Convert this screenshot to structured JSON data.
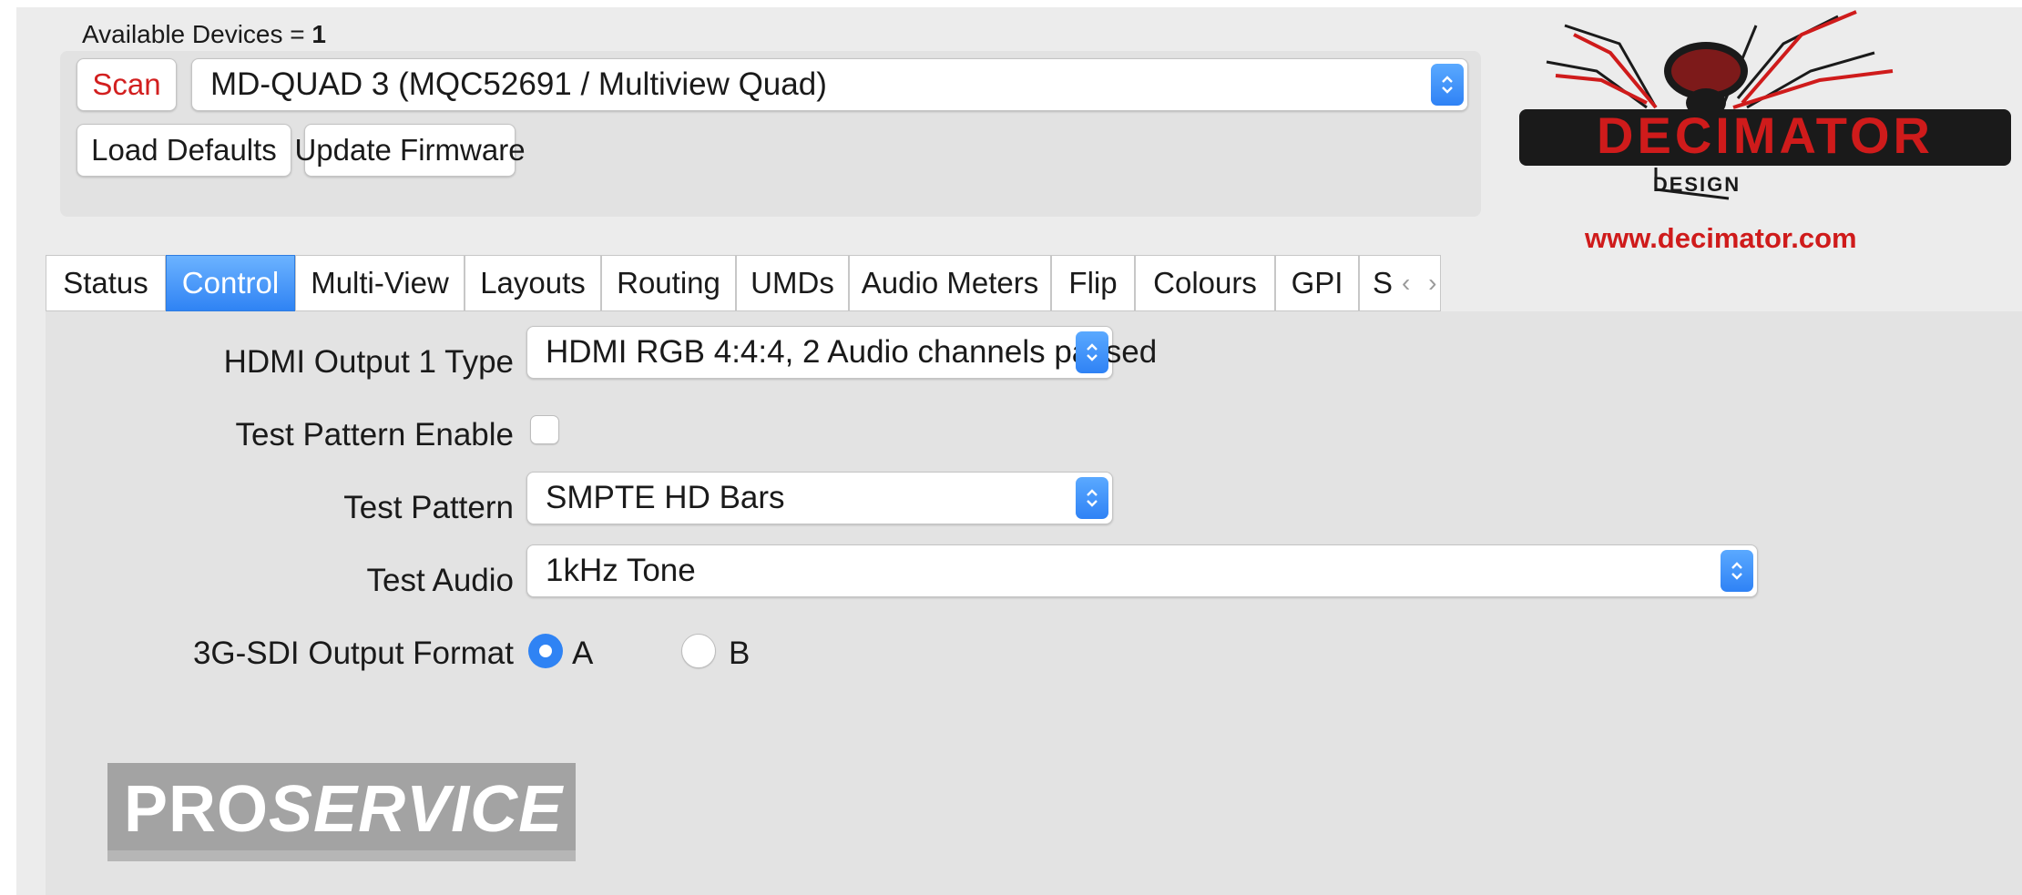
{
  "header": {
    "available_label": "Available Devices = ",
    "available_count": "1",
    "scan_label": "Scan",
    "device_selected": "MD-QUAD 3 (MQC52691 / Multiview Quad)",
    "load_defaults_label": "Load Defaults",
    "update_firmware_label": "Update Firmware"
  },
  "brand": {
    "logo_word": "DECIMATOR",
    "logo_sub": "DESIGN",
    "url": "www.decimator.com",
    "colors": {
      "red": "#cf1b1b",
      "dark": "#1a1a1a"
    }
  },
  "tabs": [
    {
      "label": "Status",
      "active": false
    },
    {
      "label": "Control",
      "active": true
    },
    {
      "label": "Multi-View",
      "active": false
    },
    {
      "label": "Layouts",
      "active": false
    },
    {
      "label": "Routing",
      "active": false
    },
    {
      "label": "UMDs",
      "active": false
    },
    {
      "label": "Audio Meters",
      "active": false
    },
    {
      "label": "Flip",
      "active": false
    },
    {
      "label": "Colours",
      "active": false
    },
    {
      "label": "GPI",
      "active": false
    }
  ],
  "tab_overflow": {
    "label": "S",
    "arrows": "‹ ›"
  },
  "control": {
    "hdmi_output_label": "HDMI Output 1 Type",
    "hdmi_output_value": "HDMI RGB 4:4:4, 2 Audio channels passed",
    "test_pattern_enable_label": "Test Pattern Enable",
    "test_pattern_enable_checked": false,
    "test_pattern_label": "Test Pattern",
    "test_pattern_value": "SMPTE HD Bars",
    "test_audio_label": "Test Audio",
    "test_audio_value": "1kHz Tone",
    "sdi_format_label": "3G-SDI Output Format",
    "sdi_option_a": "A",
    "sdi_option_b": "B",
    "sdi_selected": "A"
  },
  "watermark": {
    "part1": "PRO",
    "part2": "SERVICE"
  },
  "colors": {
    "accent": "#2f83f4",
    "window_bg": "#ececec",
    "panel_bg": "#e3e3e3"
  }
}
